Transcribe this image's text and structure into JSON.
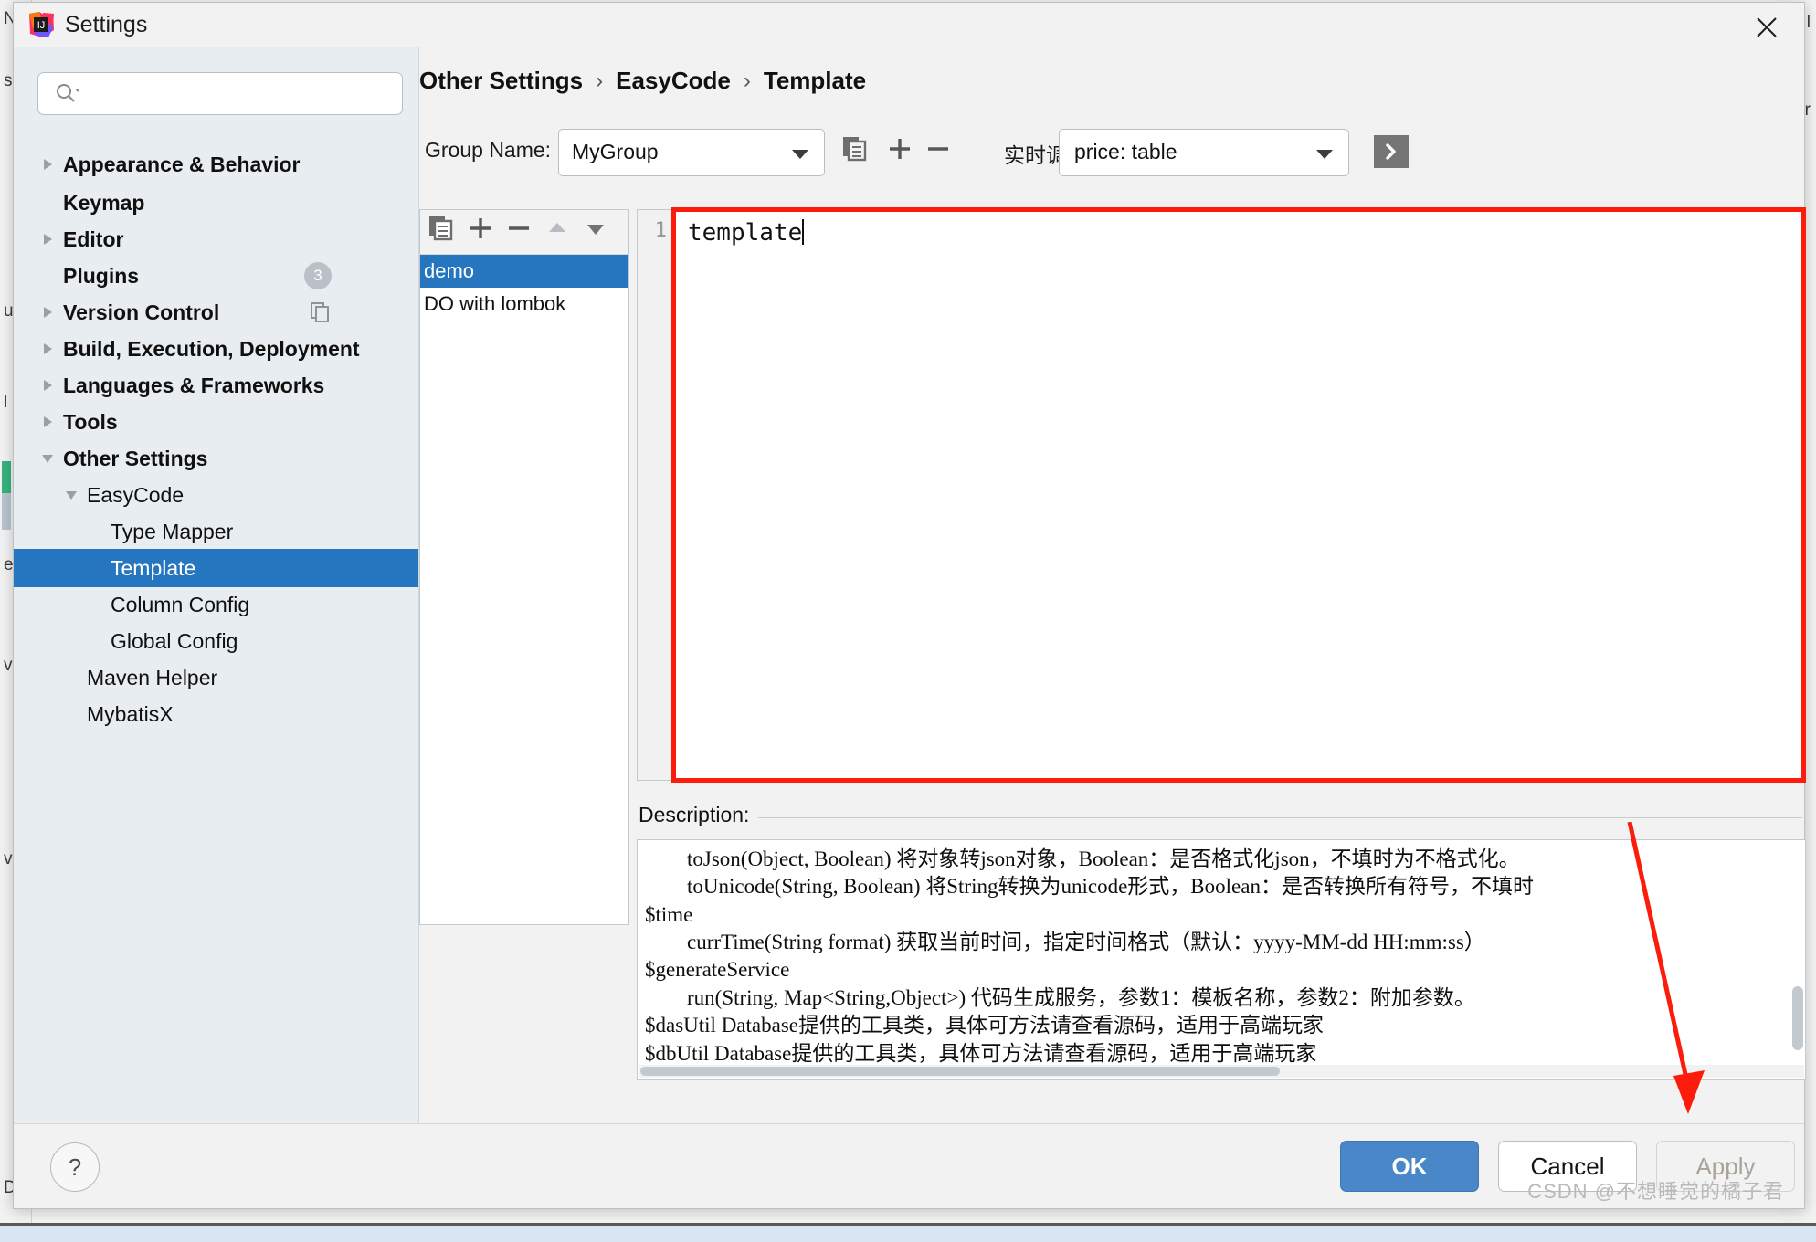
{
  "window": {
    "title": "Settings",
    "app_icon": "intellij-idea-icon",
    "close_label": "✕"
  },
  "search": {
    "value": "",
    "placeholder": "",
    "icon": "search-icon"
  },
  "sidebar": {
    "items": [
      {
        "label": "Appearance & Behavior",
        "arrow": "right",
        "indent": 0,
        "bold": true,
        "selected": false
      },
      {
        "label": "Keymap",
        "arrow": "none",
        "indent": 0,
        "bold": true,
        "selected": false
      },
      {
        "label": "Editor",
        "arrow": "right",
        "indent": 0,
        "bold": true,
        "selected": false
      },
      {
        "label": "Plugins",
        "arrow": "none",
        "indent": 0,
        "bold": true,
        "selected": false,
        "badge": "3"
      },
      {
        "label": "Version Control",
        "arrow": "right",
        "indent": 0,
        "bold": true,
        "selected": false,
        "trailing_icon": "copy-icon"
      },
      {
        "label": "Build, Execution, Deployment",
        "arrow": "right",
        "indent": 0,
        "bold": true,
        "selected": false
      },
      {
        "label": "Languages & Frameworks",
        "arrow": "right",
        "indent": 0,
        "bold": true,
        "selected": false
      },
      {
        "label": "Tools",
        "arrow": "right",
        "indent": 0,
        "bold": true,
        "selected": false
      },
      {
        "label": "Other Settings",
        "arrow": "down",
        "indent": 0,
        "bold": true,
        "selected": false
      },
      {
        "label": "EasyCode",
        "arrow": "down",
        "indent": 1,
        "bold": false,
        "selected": false
      },
      {
        "label": "Type Mapper",
        "arrow": "none",
        "indent": 2,
        "bold": false,
        "selected": false
      },
      {
        "label": "Template",
        "arrow": "none",
        "indent": 2,
        "bold": false,
        "selected": true
      },
      {
        "label": "Column Config",
        "arrow": "none",
        "indent": 2,
        "bold": false,
        "selected": false
      },
      {
        "label": "Global Config",
        "arrow": "none",
        "indent": 2,
        "bold": false,
        "selected": false
      },
      {
        "label": "Maven Helper",
        "arrow": "none",
        "indent": 1,
        "bold": false,
        "selected": false
      },
      {
        "label": "MybatisX",
        "arrow": "none",
        "indent": 1,
        "bold": false,
        "selected": false
      }
    ]
  },
  "breadcrumb": {
    "items": [
      "Other Settings",
      "EasyCode",
      "Template"
    ],
    "separator": "›"
  },
  "toolbar": {
    "group_name_label": "Group Name:",
    "group_name_value": "MyGroup",
    "copy_icon": "copy-icon",
    "add_icon": "plus-icon",
    "remove_icon": "minus-icon",
    "debug_label": "实时调试",
    "table_select_value": "price: table",
    "run_icon": "chevron-right-run-icon"
  },
  "template_list": {
    "toolbar": {
      "copy_icon": "copy-icon",
      "add_icon": "plus-icon",
      "remove_icon": "minus-icon",
      "move_up_icon": "triangle-up-icon",
      "move_down_icon": "triangle-down-icon"
    },
    "items": [
      {
        "label": "demo",
        "selected": true
      },
      {
        "label": "DO with lombok",
        "selected": false
      }
    ]
  },
  "editor": {
    "line_number": "1",
    "content": "template",
    "highlight_color": "#fb1c0c"
  },
  "description": {
    "title": "Description:",
    "lines": [
      {
        "text": "toJson(Object, Boolean) 将对象转json对象，Boolean：是否格式化json，不填时为不格式化。",
        "indent": true
      },
      {
        "text": "toUnicode(String, Boolean) 将String转换为unicode形式，Boolean：是否转换所有符号，不填时",
        "indent": true
      },
      {
        "text": "$time",
        "indent": false
      },
      {
        "text": "currTime(String format) 获取当前时间，指定时间格式（默认：yyyy-MM-dd HH:mm:ss）",
        "indent": true
      },
      {
        "text": "$generateService",
        "indent": false
      },
      {
        "text": "run(String, Map<String,Object>) 代码生成服务，参数1：模板名称，参数2：附加参数。",
        "indent": true
      },
      {
        "text": "$dasUtil  Database提供的工具类，具体可方法请查看源码，适用于高端玩家",
        "indent": false
      },
      {
        "text": "$dbUtil   Database提供的工具类，具体可方法请查看源码，适用于高端玩家",
        "indent": false
      }
    ]
  },
  "footer": {
    "help_label": "?",
    "ok_label": "OK",
    "cancel_label": "Cancel",
    "apply_label": "Apply"
  },
  "watermark": "CSDN @不想睡觉的橘子君",
  "background_editor": {
    "left_labels": [
      "N",
      "s",
      "u",
      "l",
      "e",
      "v",
      "v",
      "D"
    ],
    "right_labels": [
      "l",
      "r"
    ]
  },
  "colors": {
    "selection_blue": "#2675bf",
    "primary_button": "#4a87c8",
    "sidebar_bg": "#e8edf1",
    "annotation_red": "#fb1c0c"
  }
}
